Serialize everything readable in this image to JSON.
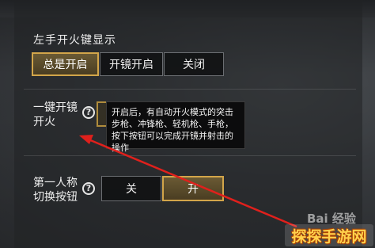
{
  "section1": {
    "title": "左手开火键显示",
    "options": [
      "总是开启",
      "开镜开启",
      "关闭"
    ]
  },
  "section2": {
    "label_line1": "一键开镜",
    "label_line2": "开火",
    "help": "?",
    "tooltip": "开启后，有自动开火模式的突击步枪、冲锋枪、轻机枪、手枪，按下按钮可以完成开镜并射击的操作"
  },
  "section3": {
    "label_line1": "第一人称",
    "label_line2": "切换按钮",
    "help": "?",
    "options": [
      "关",
      "开"
    ]
  },
  "watermark": "Bai 经验",
  "badge": "探探手游网"
}
